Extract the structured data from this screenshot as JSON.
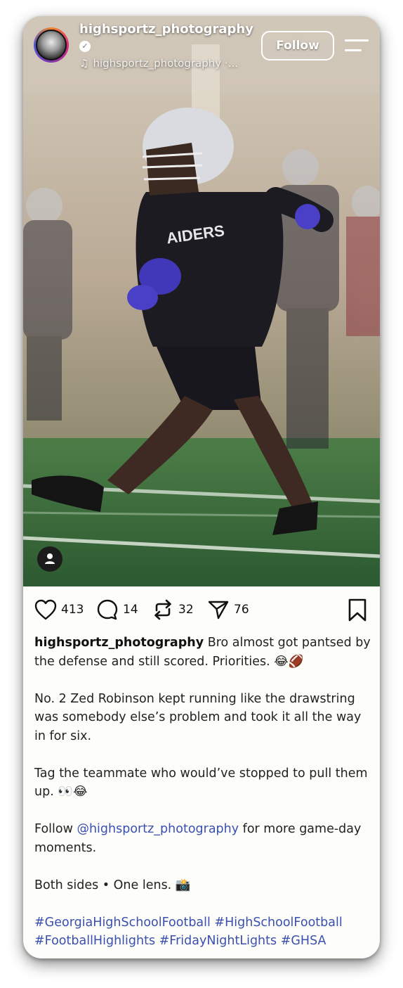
{
  "header": {
    "username": "highsportz_photography",
    "music_label": "highsportz_photography ·...",
    "follow_label": "Follow"
  },
  "actions": {
    "likes": "413",
    "comments": "14",
    "reposts": "32",
    "shares": "76"
  },
  "caption": {
    "author": "highsportz_photography",
    "line1": "Bro almost got pantsed by the defense and still scored. Priorities. 😂🏈",
    "para2": "No. 2 Zed Robinson kept running like the drawstring was somebody else’s problem and took it all the way in for six.",
    "para3": "Tag the teammate who would’ve stopped to pull them up. 👀😂",
    "follow_prefix": "Follow ",
    "follow_mention": "@highsportz_photography",
    "follow_suffix": " for more game-day moments.",
    "para5": "Both sides • One lens. 📸",
    "hashtags_line1": "#GeorgiaHighSchoolFootball #HighSchoolFootball",
    "hashtags_line2": "#FootballHighlights #FridayNightLights #GHSA"
  },
  "colors": {
    "link": "#3a4fb0",
    "background": "#fdfdf9",
    "text": "#222222"
  },
  "icons": [
    "music-note-icon",
    "verified-icon",
    "menu-icon",
    "person-icon",
    "heart-icon",
    "comment-icon",
    "repost-icon",
    "share-icon",
    "bookmark-icon"
  ]
}
